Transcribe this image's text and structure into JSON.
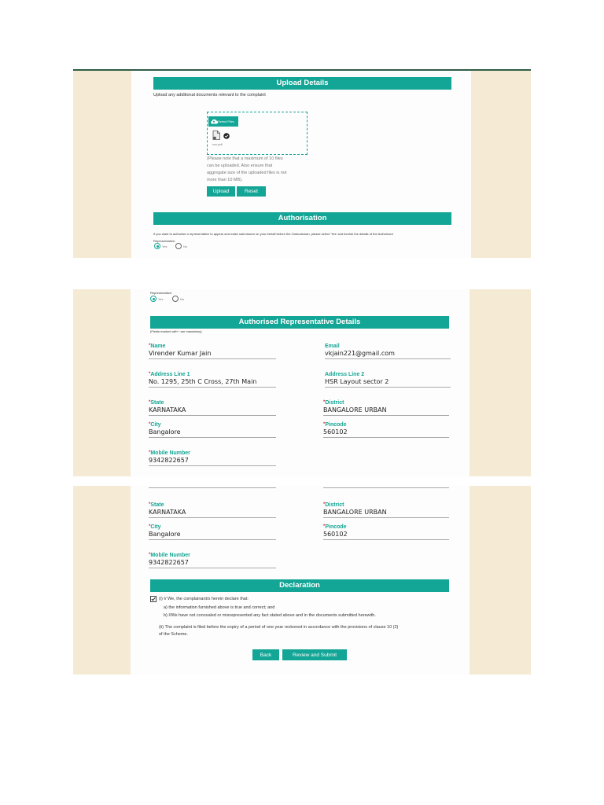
{
  "upload": {
    "title": "Upload Details",
    "instruction": "Upload any additional documents relevant to the complaint",
    "select_files": "Select Files",
    "file_name": "xxx.pdf",
    "note_lines": [
      "(Please note that a maximum of 10 files",
      "can be uploaded. Also ensure that",
      "aggregate size of the uploaded files is not",
      "more than 10 MB)."
    ],
    "upload_btn": "Upload",
    "reset_btn": "Reset"
  },
  "authorisation": {
    "title": "Authorisation",
    "text": "If you want to authorise a representative to appear and make submission on your behalf before the Ombudsman, please select 'Yes' and furnish the details of the Authorised",
    "label": "Representative:",
    "yes": "Yes",
    "no": "No",
    "selected": "Yes"
  },
  "representative": {
    "title": "Authorised Representative Details",
    "mandatory_note": "(Fields marked with * are mandatory)",
    "fields": {
      "name": {
        "label": "Name",
        "value": "Virender Kumar Jain"
      },
      "email": {
        "label": "Email",
        "value": "vkjain221@gmail.com"
      },
      "address1": {
        "label": "Address Line 1",
        "value": "No. 1295, 25th C Cross, 27th Main"
      },
      "address2": {
        "label": "Address Line 2",
        "value": "HSR Layout sector 2"
      },
      "state": {
        "label": "State",
        "value": "KARNATAKA"
      },
      "district": {
        "label": "District",
        "value": "BANGALORE URBAN"
      },
      "city": {
        "label": "City",
        "value": "Bangalore"
      },
      "pincode": {
        "label": "Pincode",
        "value": "560102"
      },
      "mobile": {
        "label": "Mobile Number",
        "value": "9342822657"
      }
    }
  },
  "declaration": {
    "title": "Declaration",
    "line_i": "(i) I/ We, the complainant/s herein declare that:",
    "line_a": "a) the information furnished above is true and correct; and",
    "line_b": "b) I/We have not concealed or misrepresented any fact stated above and in the documents submitted herewith.",
    "line_ii_1": "(ii) The complaint is filed before the expiry of a period of one year reckoned in accordance with the provisions of clause 10 (2)",
    "line_ii_2": "of the Scheme.",
    "checked": true,
    "back_btn": "Back",
    "submit_btn": "Review and Submit"
  },
  "colors": {
    "accent": "#13a595",
    "side": "#f5ebd4",
    "required": "#dd3333"
  },
  "icons": [
    "cloud-upload-icon",
    "document-icon",
    "check-circle-icon",
    "checkbox-check-icon"
  ]
}
